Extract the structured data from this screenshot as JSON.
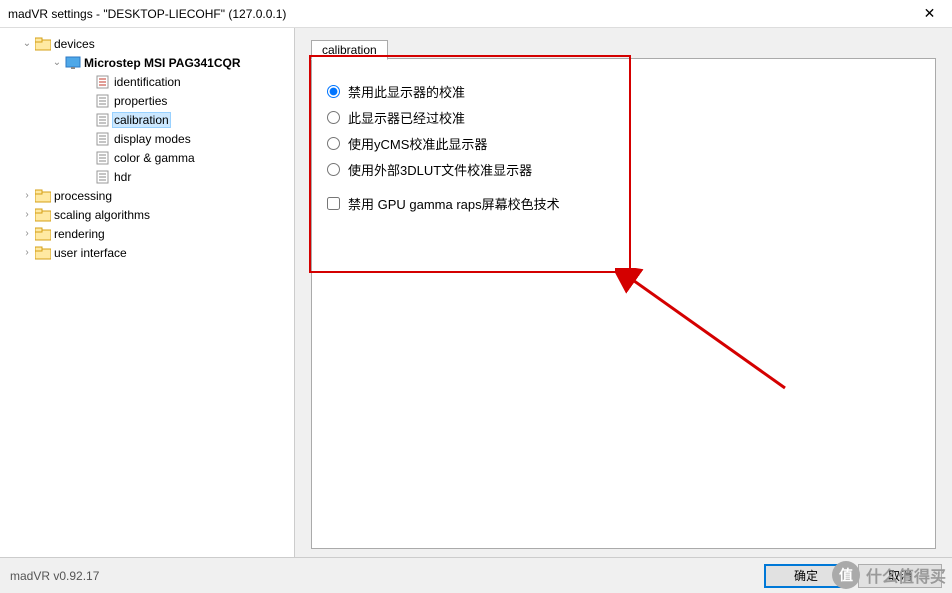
{
  "window": {
    "title": "madVR settings - \"DESKTOP-LIECOHF\" (127.0.0.1)"
  },
  "tree": {
    "devices": "devices",
    "monitor": "Microstep MSI PAG341CQR",
    "identification": "identification",
    "properties": "properties",
    "calibration": "calibration",
    "display_modes": "display modes",
    "color_gamma": "color & gamma",
    "hdr": "hdr",
    "processing": "processing",
    "scaling": "scaling algorithms",
    "rendering": "rendering",
    "ui": "user interface"
  },
  "tab": {
    "label": "calibration"
  },
  "options": {
    "radio1": "禁用此显示器的校准",
    "radio2": "此显示器已经过校准",
    "radio3": "使用yCMS校准此显示器",
    "radio4": "使用外部3DLUT文件校准显示器",
    "checkbox1": "禁用 GPU gamma raps屏幕校色技术"
  },
  "footer": {
    "version": "madVR v0.92.17",
    "ok": "确定",
    "cancel": "取消"
  },
  "watermark": {
    "logo": "值",
    "text": "什么值得买"
  }
}
